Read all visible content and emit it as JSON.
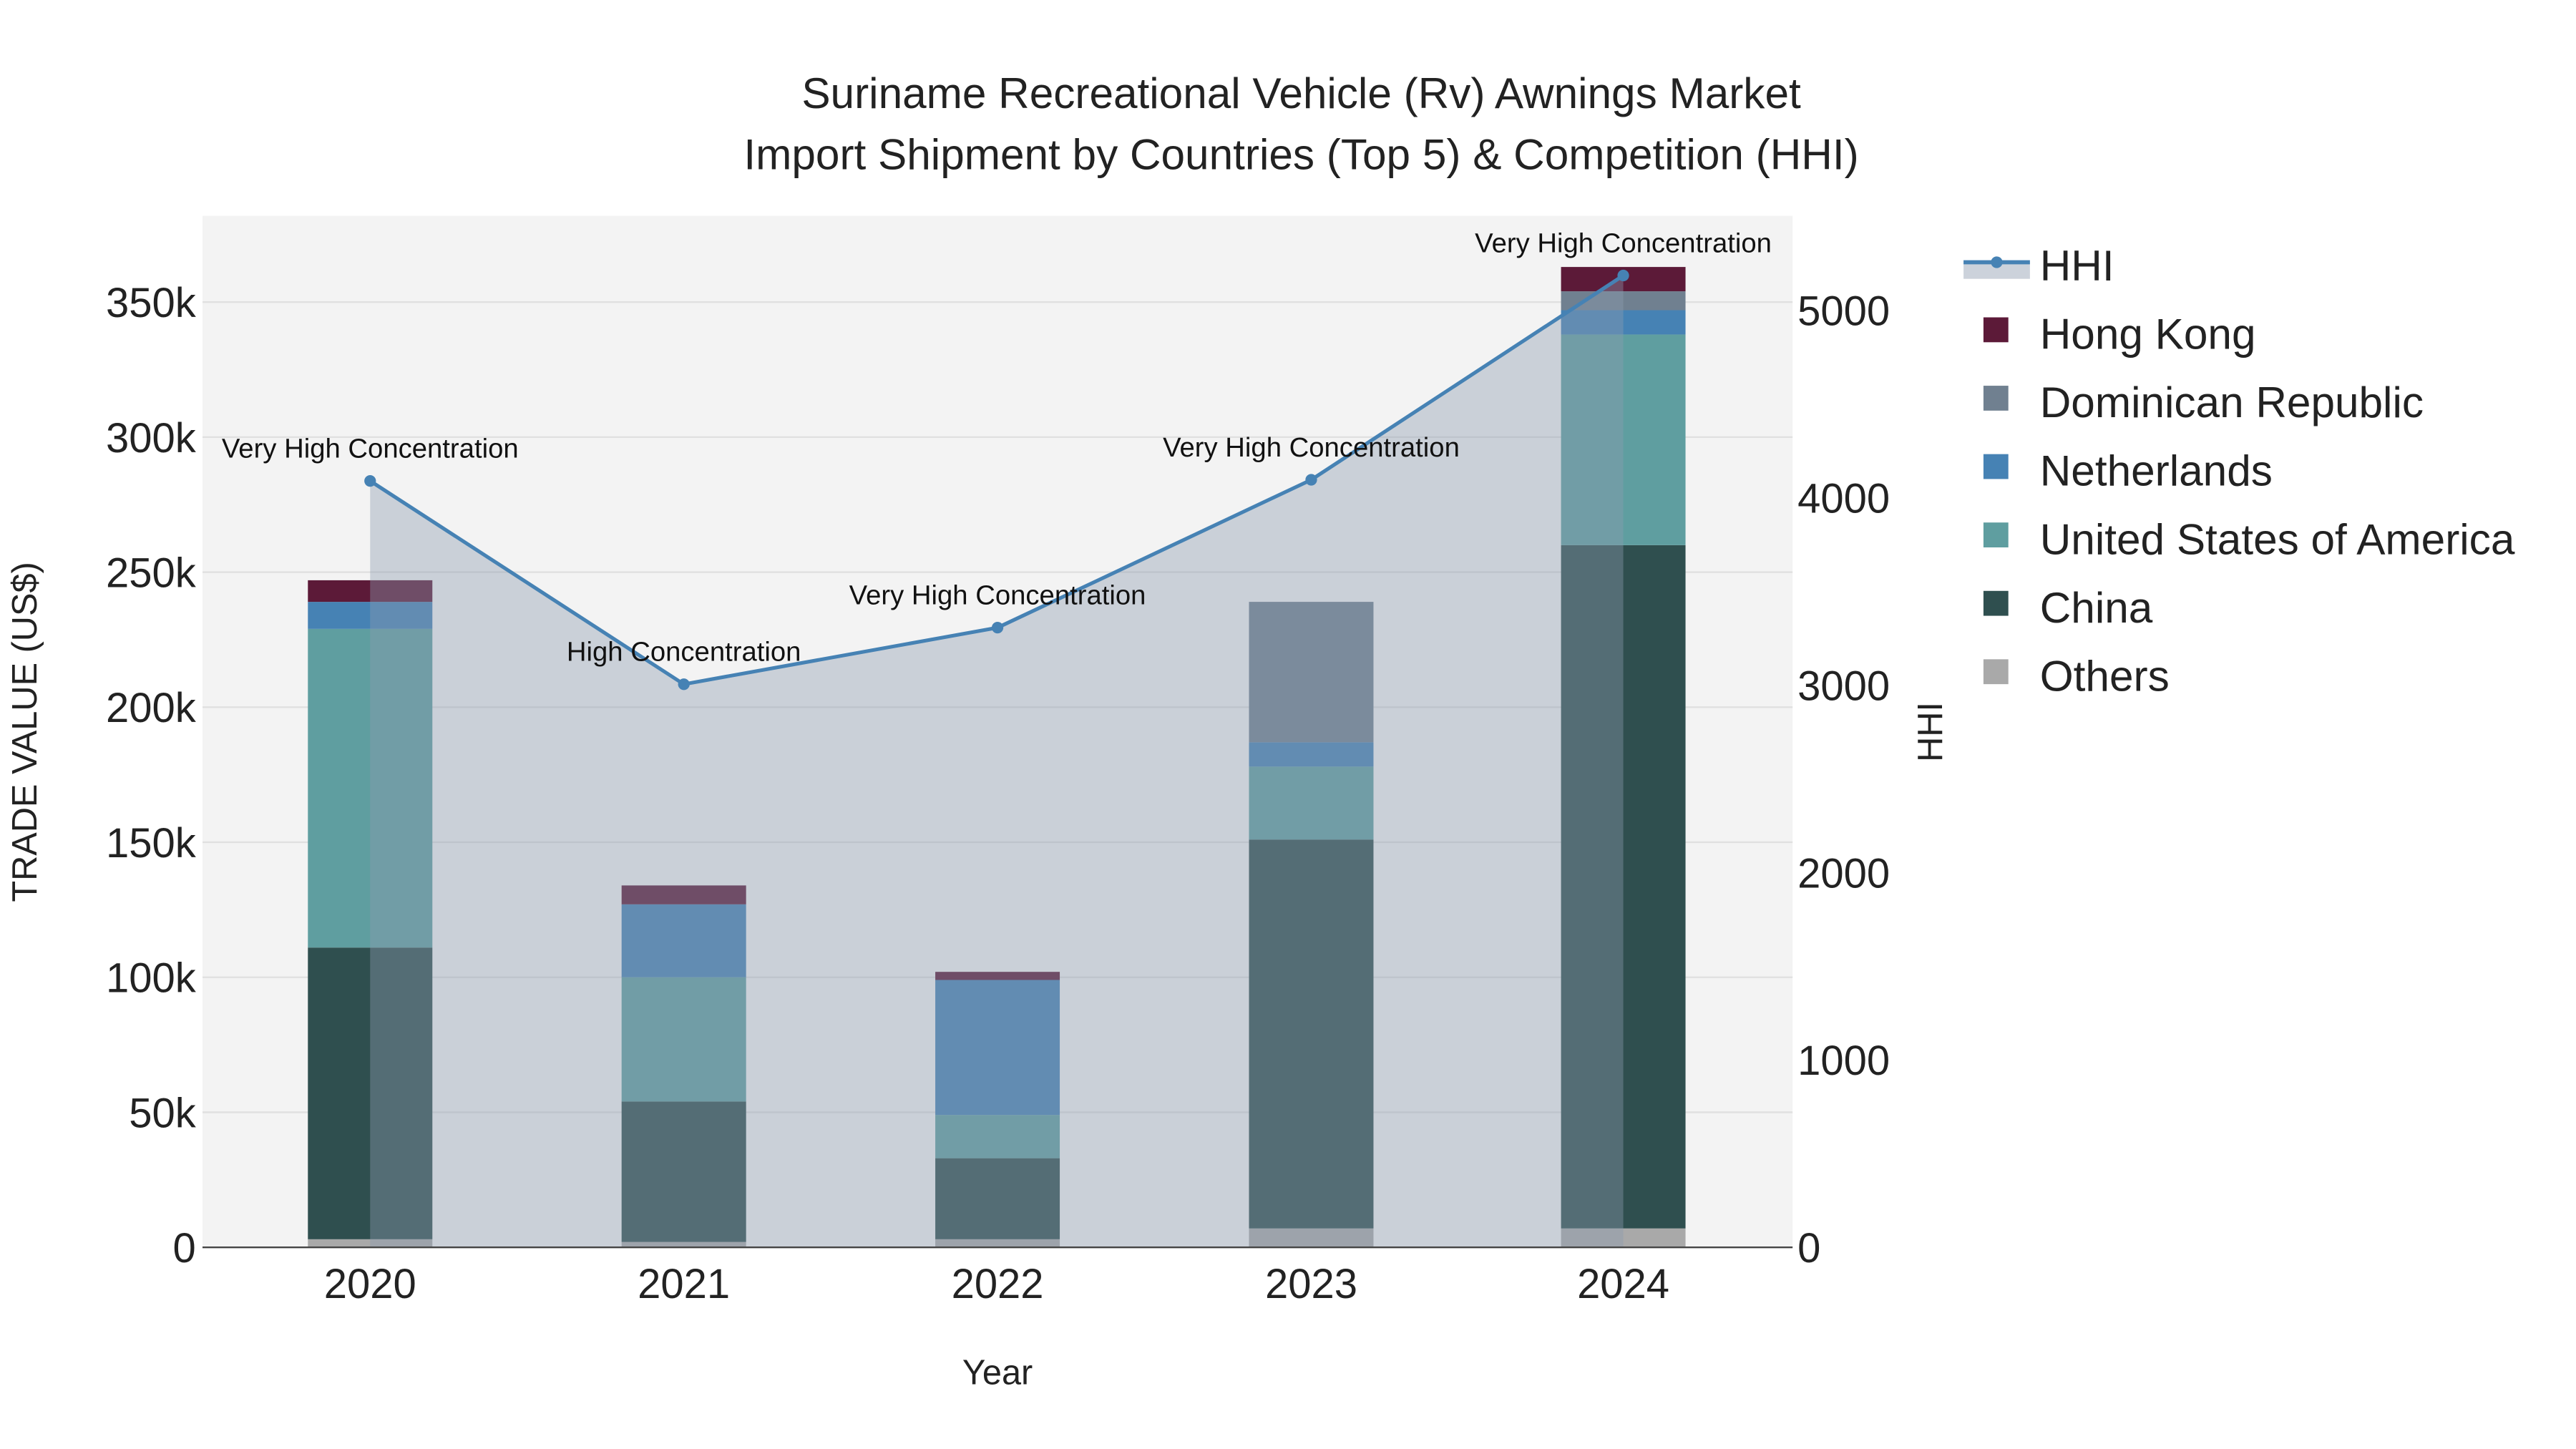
{
  "chart_data": {
    "type": "bar",
    "title_line1": "Suriname Recreational Vehicle (Rv) Awnings Market",
    "title_line2": "Import Shipment by Countries (Top 5) & Competition (HHI)",
    "xlabel": "Year",
    "ylabel": "TRADE VALUE (US$)",
    "y2label": "HHI",
    "categories": [
      "2020",
      "2021",
      "2022",
      "2023",
      "2024"
    ],
    "ylim": [
      0,
      380000
    ],
    "y2lim": [
      0,
      5500
    ],
    "yticks": [
      0,
      50000,
      100000,
      150000,
      200000,
      250000,
      300000,
      350000
    ],
    "ytick_labels": [
      "0",
      "50k",
      "100k",
      "150k",
      "200k",
      "250k",
      "300k",
      "350k"
    ],
    "y2ticks": [
      0,
      1000,
      2000,
      3000,
      4000,
      5000
    ],
    "y2tick_labels": [
      "0",
      "1000",
      "2000",
      "3000",
      "4000",
      "5000"
    ],
    "grid": true,
    "legend_position": "right",
    "series": [
      {
        "name": "Others",
        "color": "#a9a9a9",
        "values": [
          3000,
          2000,
          3000,
          7000,
          7000
        ]
      },
      {
        "name": "China",
        "color": "#2f4f4f",
        "values": [
          108000,
          52000,
          30000,
          144000,
          253000
        ]
      },
      {
        "name": "United States of America",
        "color": "#5f9ea0",
        "values": [
          118000,
          46000,
          16000,
          27000,
          78000
        ]
      },
      {
        "name": "Netherlands",
        "color": "#4682b4",
        "values": [
          10000,
          27000,
          50000,
          9000,
          9000
        ]
      },
      {
        "name": "Dominican Republic",
        "color": "#708090",
        "values": [
          0,
          0,
          0,
          52000,
          7000
        ]
      },
      {
        "name": "Hong Kong",
        "color": "#5c1a38",
        "values": [
          8000,
          7000,
          3000,
          0,
          9000
        ]
      }
    ],
    "hhi": {
      "name": "HHI",
      "color": "#4682b4",
      "values": [
        4090,
        3005,
        3307,
        4096,
        5186
      ],
      "annotations": [
        "Very High Concentration",
        "High Concentration",
        "Very High Concentration",
        "Very High Concentration",
        "Very High Concentration"
      ]
    },
    "legend_order": [
      "HHI",
      "Hong Kong",
      "Dominican Republic",
      "Netherlands",
      "United States of America",
      "China",
      "Others"
    ]
  }
}
